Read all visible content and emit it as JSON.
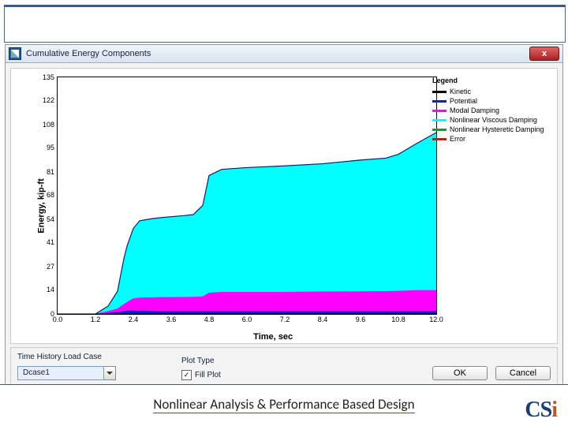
{
  "window": {
    "title": "Cumulative Energy Components",
    "close_glyph": "x"
  },
  "chart_data": {
    "type": "area",
    "title": "",
    "xlabel": "Time, sec",
    "ylabel": "Energy, kip-ft",
    "xlim": [
      0.0,
      12.0
    ],
    "ylim": [
      0,
      135
    ],
    "xticks": [
      0.0,
      1.2,
      2.4,
      3.6,
      4.8,
      6.0,
      7.2,
      8.4,
      9.6,
      10.8,
      12.0
    ],
    "yticks": [
      0,
      14,
      27,
      41,
      54,
      68,
      81,
      95,
      108,
      122,
      135
    ],
    "x": [
      0.0,
      1.2,
      1.6,
      1.9,
      2.0,
      2.1,
      2.2,
      2.3,
      2.4,
      2.6,
      3.0,
      3.3,
      3.6,
      4.0,
      4.3,
      4.6,
      4.8,
      5.2,
      6.0,
      7.2,
      8.4,
      9.6,
      10.4,
      10.8,
      11.4,
      12.0
    ],
    "series": [
      {
        "name": "Kinetic",
        "color": "#000000",
        "values": [
          0,
          0,
          0,
          0,
          0,
          0,
          0,
          0,
          0,
          0,
          0,
          0,
          0,
          0,
          0,
          0,
          0,
          0,
          0,
          0,
          0,
          0,
          0,
          0,
          0,
          0
        ]
      },
      {
        "name": "Potential",
        "color": "#1020c0",
        "values": [
          0,
          0,
          0.5,
          1,
          1.3,
          1.5,
          1.7,
          1.8,
          1.8,
          1.7,
          1.6,
          1.5,
          1.5,
          1.5,
          1.5,
          1.5,
          1.5,
          1.5,
          1.5,
          1.5,
          1.5,
          1.5,
          1.5,
          1.5,
          1.5,
          1.5
        ]
      },
      {
        "name": "Modal Damping",
        "color": "#ff00ff",
        "values": [
          0,
          0,
          1,
          2,
          3,
          4,
          5,
          6,
          7,
          7.5,
          7.8,
          8,
          8,
          8.1,
          8.2,
          8.4,
          10.5,
          11,
          11,
          11,
          11.2,
          11.3,
          11.4,
          11.6,
          12,
          12
        ]
      },
      {
        "name": "Nonlinear Viscous Damping",
        "color": "#00ffff",
        "values": [
          0,
          0,
          3,
          10,
          18,
          26,
          32,
          36,
          40,
          44,
          45,
          45.5,
          46,
          46.5,
          47,
          52,
          67,
          70,
          71,
          72,
          73,
          75,
          76,
          78,
          84,
          90
        ]
      },
      {
        "name": "Nonlinear Hysteretic Damping",
        "color": "#00a040",
        "values": [
          0,
          0,
          0,
          0,
          0,
          0,
          0,
          0,
          0,
          0,
          0,
          0,
          0,
          0,
          0,
          0,
          0,
          0,
          0,
          0,
          0,
          0,
          0,
          0,
          0,
          0
        ]
      },
      {
        "name": "Error",
        "color": "#ff0000",
        "values": [
          0,
          0,
          0,
          0,
          0,
          0,
          0,
          0,
          0,
          0,
          0,
          0,
          0,
          0,
          0,
          0,
          0,
          0,
          0,
          0,
          0,
          0,
          0,
          0,
          0,
          0
        ]
      }
    ],
    "legend_header": "Legend"
  },
  "controls": {
    "load_case_label": "Time History Load Case",
    "load_case_value": "Dcase1",
    "plot_type_label": "Plot Type",
    "plot_checkbox_label": "Fill Plot",
    "plot_checkbox_checked": "✓",
    "ok_label": "OK",
    "cancel_label": "Cancel"
  },
  "footer": {
    "caption": "Nonlinear Analysis & Performance Based Design",
    "logo_c": "C",
    "logo_s": "S",
    "logo_i": "i"
  }
}
